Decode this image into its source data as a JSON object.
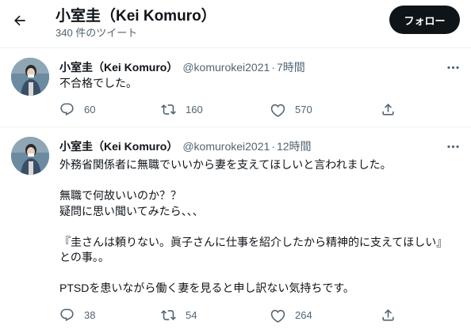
{
  "header": {
    "name": "小室圭（Kei Komuro）",
    "tweet_count": "340 件のツイート",
    "follow_label": "フォロー"
  },
  "tweets": [
    {
      "author_name": "小室圭（Kei Komuro）",
      "handle": "@komurokei2021",
      "separator": "·",
      "time": "7時間",
      "lines": [
        "不合格でした。"
      ],
      "replies": "60",
      "retweets": "160",
      "likes": "570"
    },
    {
      "author_name": "小室圭（Kei Komuro）",
      "handle": "@komurokei2021",
      "separator": "·",
      "time": "12時間",
      "lines": [
        "外務省関係者に無職でいいから妻を支えてほしいと言われました。",
        "無職で何故いいのか？？",
        "疑問に思い聞いてみたら、、、",
        "『圭さんは頼りない。眞子さんに仕事を紹介したから精神的に支えてほしい』",
        "との事。。",
        "PTSDを患いながら働く妻を見ると申し訳ない気持ちです。"
      ],
      "replies": "38",
      "retweets": "54",
      "likes": "264"
    }
  ],
  "icons": {
    "back": "arrow-left-icon",
    "more": "more-horizontal-icon",
    "reply": "reply-icon",
    "retweet": "retweet-icon",
    "like": "heart-icon",
    "share": "share-icon"
  },
  "colors": {
    "text": "#0f1419",
    "secondary": "#536471",
    "follow_button": "#0f1419",
    "divider": "#eff3f4"
  }
}
